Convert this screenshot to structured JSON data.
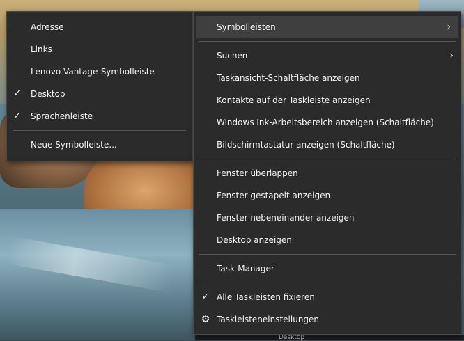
{
  "main_menu": {
    "items": [
      {
        "label": "Symbolleisten",
        "submenu": true,
        "highlighted": true
      },
      {
        "label": "Suchen",
        "submenu": true
      },
      {
        "label": "Taskansicht-Schaltfläche anzeigen"
      },
      {
        "label": "Kontakte auf der Taskleiste anzeigen"
      },
      {
        "label": "Windows Ink-Arbeitsbereich anzeigen (Schaltfläche)"
      },
      {
        "label": "Bildschirmtastatur anzeigen (Schaltfläche)"
      },
      {
        "label": "Fenster überlappen"
      },
      {
        "label": "Fenster gestapelt anzeigen"
      },
      {
        "label": "Fenster nebeneinander anzeigen"
      },
      {
        "label": "Desktop anzeigen"
      },
      {
        "label": "Task-Manager"
      },
      {
        "label": "Alle Taskleisten fixieren",
        "checked": true
      },
      {
        "label": "Taskleisteneinstellungen",
        "icon": "gear-icon"
      }
    ]
  },
  "sub_menu": {
    "items": [
      {
        "label": "Adresse"
      },
      {
        "label": "Links"
      },
      {
        "label": "Lenovo Vantage-Symbolleiste"
      },
      {
        "label": "Desktop",
        "checked": true
      },
      {
        "label": "Sprachenleiste",
        "checked": true
      },
      {
        "label": "Neue Symbolleiste..."
      }
    ]
  },
  "taskbar": {
    "label": "Desktop"
  },
  "glyphs": {
    "check": "✓",
    "chevron": "›",
    "gear": "⚙"
  }
}
